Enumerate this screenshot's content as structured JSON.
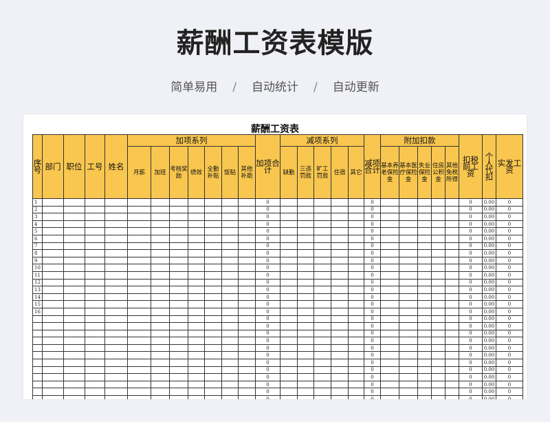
{
  "page_title": "薪酬工资表模版",
  "features": [
    "简单易用",
    "自动统计",
    "自动更新"
  ],
  "separator": "/",
  "sheet_title": "薪酬工资表",
  "groups": {
    "add": "加项系列",
    "deduct": "减项系列",
    "withhold": "附加扣款"
  },
  "columns": {
    "seq": "序号",
    "dept": "部门",
    "position": "职位",
    "emp_no": "工号",
    "name": "姓名",
    "monthly_salary": "月薪",
    "overtime": "加班",
    "assessment_bonus": "考核奖励",
    "performance": "绩效",
    "attendance_allowance": "全勤补贴",
    "meal_allowance": "饭贴",
    "other_allowance": "其他补助",
    "add_total": "加项合计",
    "absence": "缺勤",
    "violation_fine": "三违罚款",
    "absentee_fine": "旷工罚款",
    "dormitory": "住宿",
    "other": "其它",
    "deduct_total": "减项合计",
    "pension": "基本养老保险金",
    "medical": "基本医疗保险金",
    "unemployment": "失业保险金",
    "housing_fund": "住房公积金",
    "other_tax_exempt": "其他免税所得",
    "pretax_salary": "扣税前工资",
    "personal_tax": "个人代扣",
    "net_salary": "实发工资"
  },
  "rows": {
    "numbered_count": 16,
    "total_count": 28,
    "default_add_total": "0",
    "default_deduct_total": "0",
    "default_pretax": "0",
    "default_tax": "0.00",
    "default_net": "0"
  }
}
